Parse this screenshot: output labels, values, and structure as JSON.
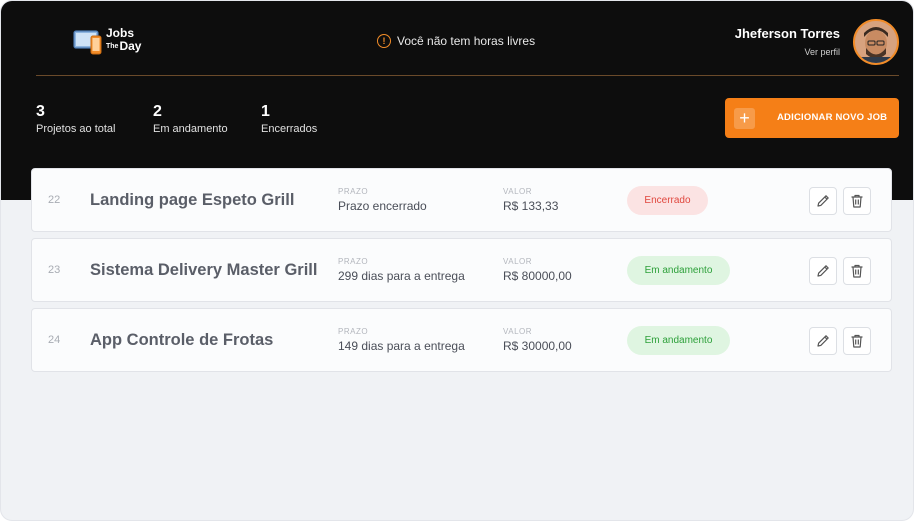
{
  "brand": {
    "line1": "Jobs",
    "line2_small": "The",
    "line2": "Day"
  },
  "notice": {
    "text": "Você não tem horas livres"
  },
  "profile": {
    "name": "Jheferson Torres",
    "link": "Ver perfil"
  },
  "stats": [
    {
      "value": "3",
      "label": "Projetos ao total"
    },
    {
      "value": "2",
      "label": "Em andamento"
    },
    {
      "value": "1",
      "label": "Encerrados"
    }
  ],
  "add_button": {
    "plus": "+",
    "label": "ADICIONAR NOVO JOB"
  },
  "jobs": [
    {
      "id": "22",
      "title": "Landing page Espeto Grill",
      "deadline_label": "PRAZO",
      "deadline": "Prazo encerrado",
      "value_label": "VALOR",
      "value": "R$ 133,33",
      "status": "Encerrado",
      "status_type": "closed"
    },
    {
      "id": "23",
      "title": "Sistema Delivery Master Grill",
      "deadline_label": "PRAZO",
      "deadline": "299 dias para a entrega",
      "value_label": "VALOR",
      "value": "R$ 80000,00",
      "status": "Em andamento",
      "status_type": "progress"
    },
    {
      "id": "24",
      "title": "App Controle de Frotas",
      "deadline_label": "PRAZO",
      "deadline": "149 dias para a entrega",
      "value_label": "VALOR",
      "value": "R$ 30000,00",
      "status": "Em andamento",
      "status_type": "progress"
    }
  ],
  "icons": {
    "notice": "warning-icon",
    "edit": "pencil-icon",
    "delete": "trash-icon"
  },
  "colors": {
    "accent": "#f57f17",
    "header_bg": "#0d0d0d",
    "closed_text": "#e0473e",
    "progress_text": "#2da03a"
  }
}
